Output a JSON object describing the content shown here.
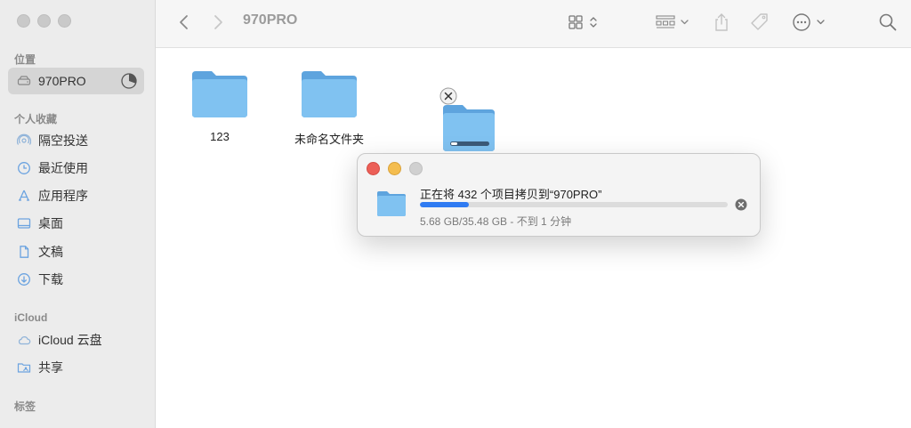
{
  "window": {
    "title": "970PRO"
  },
  "sidebar": {
    "sections": [
      {
        "title": "位置",
        "items": [
          {
            "label": "970PRO",
            "icon": "drive-icon",
            "selected": true
          }
        ]
      },
      {
        "title": "个人收藏",
        "items": [
          {
            "label": "隔空投送",
            "icon": "airdrop-icon"
          },
          {
            "label": "最近使用",
            "icon": "clock-icon"
          },
          {
            "label": "应用程序",
            "icon": "apps-icon"
          },
          {
            "label": "桌面",
            "icon": "desktop-icon"
          },
          {
            "label": "文稿",
            "icon": "document-icon"
          },
          {
            "label": "下载",
            "icon": "download-icon"
          }
        ]
      },
      {
        "title": "iCloud",
        "items": [
          {
            "label": "iCloud 云盘",
            "icon": "cloud-icon"
          },
          {
            "label": "共享",
            "icon": "shared-folder-icon"
          }
        ]
      },
      {
        "title": "标签",
        "items": []
      }
    ]
  },
  "toolbar": {
    "title": "970PRO",
    "icons": [
      "back-icon",
      "forward-icon",
      "grid-view-icon",
      "group-icon",
      "share-icon",
      "tag-icon",
      "more-icon",
      "search-icon"
    ]
  },
  "content": {
    "folders": [
      {
        "label": "123"
      },
      {
        "label": "未命名文件夹"
      },
      {
        "label": ""
      }
    ]
  },
  "copy_dialog": {
    "title": "正在将 432 个项目拷贝到“970PRO”",
    "progress_fraction": 0.16,
    "status": "5.68 GB/35.48 GB - 不到 1 分钟"
  },
  "colors": {
    "accent": "#2f7bf2",
    "folder": "#7ec0f0",
    "close": "#ec5f57",
    "minimize": "#f4bd4f",
    "zoom_inactive": "#d0d0d0"
  }
}
